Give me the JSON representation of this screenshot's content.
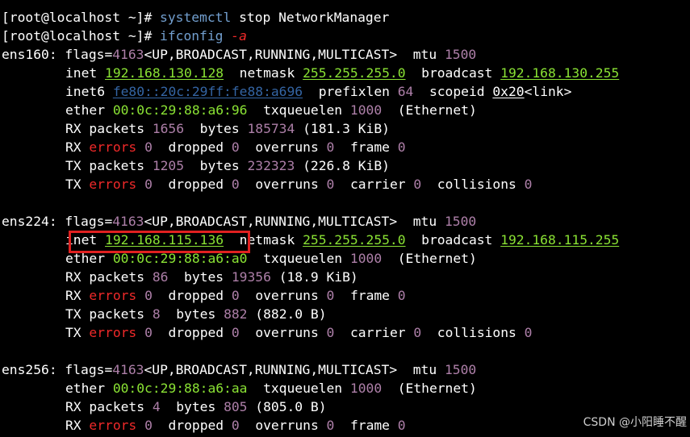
{
  "prompt": "[root@localhost ~]# ",
  "commands": [
    "systemctl stop NetworkManager",
    "ifconfig",
    "-a"
  ],
  "cmd1_name": "systemctl",
  "cmd1_args": " stop NetworkManager",
  "cmd2_name": "ifconfig",
  "cmd2_flag": "-a",
  "interfaces": [
    {
      "name": "ens160",
      "flags_num": "4163",
      "flags": "<UP,BROADCAST,RUNNING,MULTICAST>",
      "mtu": "1500",
      "inet": "192.168.130.128",
      "netmask": "255.255.255.0",
      "broadcast": "192.168.130.255",
      "inet6": "fe80::20c:29ff:fe88:a696",
      "prefixlen": "64",
      "scopeid": "0x20",
      "scope_link": "<link>",
      "ether": "00:0c:29:88:a6:96",
      "txqueuelen": "1000",
      "ether_type": "(Ethernet)",
      "rx_packets": "1656",
      "rx_bytes": "185734",
      "rx_bytes_h": "(181.3 KiB)",
      "rx_errors": "0",
      "rx_dropped": "0",
      "rx_overruns": "0",
      "rx_frame": "0",
      "tx_packets": "1205",
      "tx_bytes": "232323",
      "tx_bytes_h": "(226.8 KiB)",
      "tx_errors": "0",
      "tx_dropped": "0",
      "tx_overruns": "0",
      "tx_carrier": "0",
      "tx_collisions": "0"
    },
    {
      "name": "ens224",
      "flags_num": "4163",
      "flags": "<UP,BROADCAST,RUNNING,MULTICAST>",
      "mtu": "1500",
      "inet": "192.168.115.136",
      "netmask": "255.255.255.0",
      "broadcast": "192.168.115.255",
      "ether": "00:0c:29:88:a6:a0",
      "txqueuelen": "1000",
      "ether_type": "(Ethernet)",
      "rx_packets": "86",
      "rx_bytes": "19356",
      "rx_bytes_h": "(18.9 KiB)",
      "rx_errors": "0",
      "rx_dropped": "0",
      "rx_overruns": "0",
      "rx_frame": "0",
      "tx_packets": "8",
      "tx_bytes": "882",
      "tx_bytes_h": "(882.0 B)",
      "tx_errors": "0",
      "tx_dropped": "0",
      "tx_overruns": "0",
      "tx_carrier": "0",
      "tx_collisions": "0"
    },
    {
      "name": "ens256",
      "flags_num": "4163",
      "flags": "<UP,BROADCAST,RUNNING,MULTICAST>",
      "mtu": "1500",
      "ether": "00:0c:29:88:a6:aa",
      "txqueuelen": "1000",
      "ether_type": "(Ethernet)",
      "rx_packets": "4",
      "rx_bytes": "805",
      "rx_bytes_h": "(805.0 B)",
      "rx_errors": "0",
      "rx_dropped": "0",
      "rx_overruns": "0",
      "rx_frame": "0"
    }
  ],
  "labels": {
    "flags": ": flags=",
    "mtu": "  mtu ",
    "inet": "inet ",
    "netmask": "  netmask ",
    "broadcast": "  broadcast ",
    "inet6": "inet6 ",
    "prefixlen": "  prefixlen ",
    "scopeid": "  scopeid ",
    "ether": "ether ",
    "txqueuelen": "  txqueuelen ",
    "rx_packets": "RX packets ",
    "tx_packets": "TX packets ",
    "bytes": "  bytes ",
    "rx": "RX ",
    "tx": "TX ",
    "errors": "errors",
    "dropped": "  dropped ",
    "overruns": "  overruns ",
    "frame": "  frame ",
    "carrier": "  carrier ",
    "collisions": "  collisions "
  },
  "watermark": "CSDN @小阳睡不醒",
  "colors": {
    "background": "#000000",
    "text": "#ffffff",
    "green": "#8ae234",
    "purple": "#ad7fa8",
    "red": "#ef2929",
    "blue": "#3465a4",
    "highlight_box": "#e02020"
  }
}
